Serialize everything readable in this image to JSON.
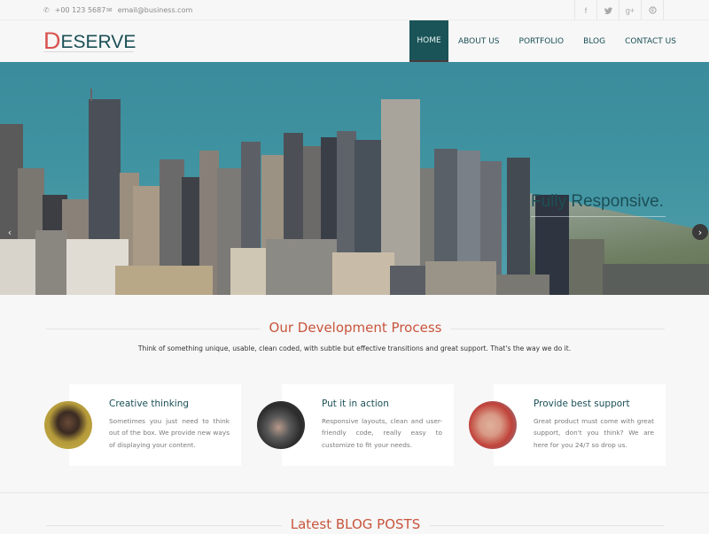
{
  "topbar": {
    "phone": "+00 123 5687",
    "email": "email@business.com",
    "phone_icon": "phone-icon",
    "email_icon": "envelope-icon",
    "social": [
      {
        "name": "facebook",
        "glyph": "f"
      },
      {
        "name": "twitter",
        "glyph": "t"
      },
      {
        "name": "google-plus",
        "glyph": "g+"
      },
      {
        "name": "skype",
        "glyph": "s"
      }
    ]
  },
  "header": {
    "logo_first": "D",
    "logo_rest": "ESERVE",
    "nav": [
      {
        "label": "HOME",
        "active": true
      },
      {
        "label": "ABOUT US",
        "active": false
      },
      {
        "label": "PORTFOLIO",
        "active": false
      },
      {
        "label": "BLOG",
        "active": false
      },
      {
        "label": "CONTACT US",
        "active": false
      }
    ]
  },
  "hero": {
    "caption": "Fully Responsive.",
    "prev_glyph": "‹",
    "next_glyph": "›"
  },
  "process": {
    "title": "Our Development Process",
    "subtitle": "Think of something unique, usable, clean coded, with subtle but effective transitions and great support. That's the way we do it.",
    "cards": [
      {
        "title": "Creative thinking",
        "text": "Sometimes you just need to think out of the box. We provide new ways of displaying your content."
      },
      {
        "title": "Put it in action",
        "text": "Responsive layouts, clean and user-friendly code, really easy to customize to fit your needs."
      },
      {
        "title": "Provide best support",
        "text": "Great product must come with great support, don't you think? We are here for you 24/7 so drop us."
      }
    ]
  },
  "blog": {
    "title": "Latest BLOG POSTS"
  },
  "colors": {
    "accent_red": "#c8553d",
    "brand_teal": "#1a5458",
    "logo_red": "#d9534f"
  }
}
